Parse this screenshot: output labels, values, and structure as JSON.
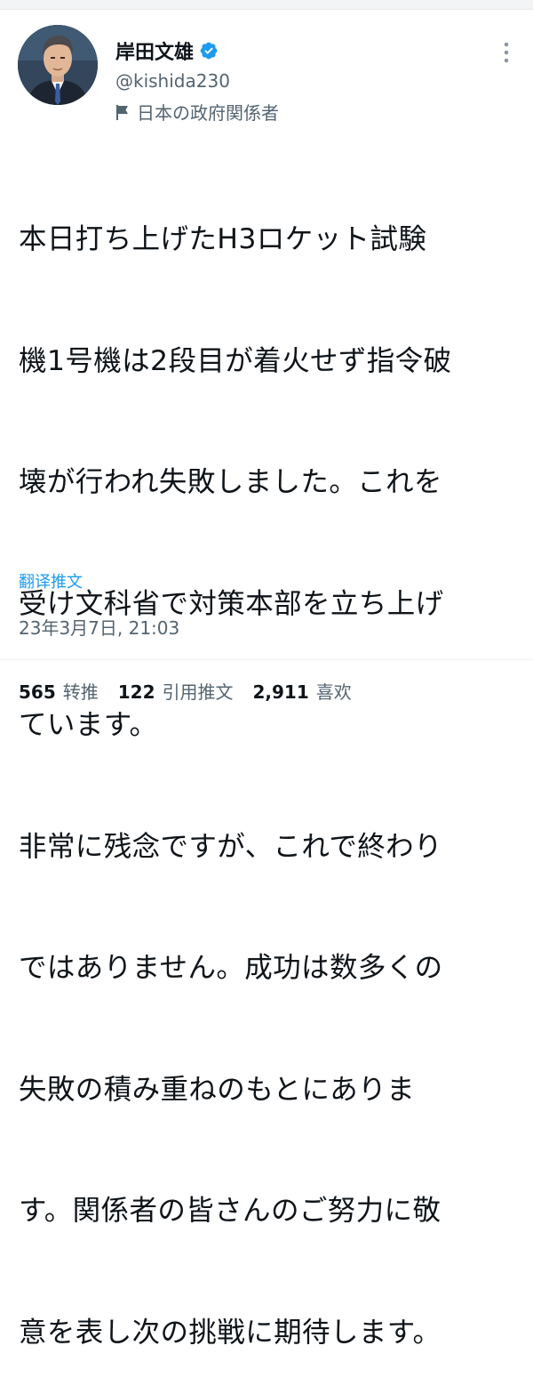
{
  "author": {
    "display_name": "岸田文雄",
    "handle": "@kishida230",
    "affiliation": "日本の政府関係者",
    "verified": true,
    "verified_color": "#1d9bf0"
  },
  "icons": {
    "verified": "verified-badge-icon",
    "affiliation": "flag-icon",
    "more": "more-options-icon"
  },
  "tweet": {
    "lines": [
      "本日打ち上げたH3ロケット試験",
      "機1号機は2段目が着火せず指令破",
      "壊が行われ失敗しました。これを",
      "受け文科省で対策本部を立ち上げ",
      "ています。",
      "非常に残念ですが、これで終わり",
      "ではありません。成功は数多くの",
      "失敗の積み重ねのもとにありま",
      "す。関係者の皆さんのご努力に敬",
      "意を表し次の挑戦に期待します。"
    ],
    "translate_label": "翻译推文",
    "timestamp": "23年3月7日, 21:03"
  },
  "stats": {
    "retweets_count": "565",
    "retweets_label": "转推",
    "quotes_count": "122",
    "quotes_label": "引用推文",
    "likes_count": "2,911",
    "likes_label": "喜欢"
  },
  "colors": {
    "text_primary": "#0f1419",
    "text_secondary": "#536471",
    "link": "#1d9bf0"
  }
}
